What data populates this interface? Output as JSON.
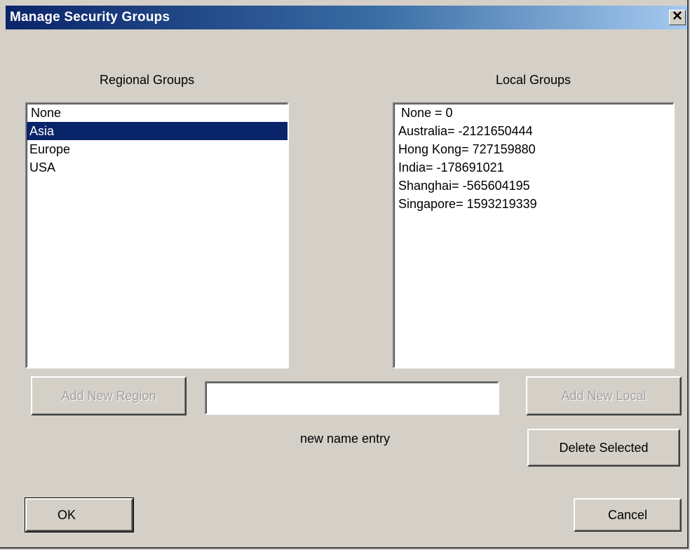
{
  "window": {
    "title": "Manage Security Groups",
    "close_glyph": "✕"
  },
  "regional": {
    "heading": "Regional Groups",
    "items": [
      {
        "label": "None",
        "selected": false
      },
      {
        "label": "Asia",
        "selected": true
      },
      {
        "label": "Europe",
        "selected": false
      },
      {
        "label": "USA",
        "selected": false
      }
    ]
  },
  "local": {
    "heading": "Local Groups",
    "items": [
      {
        "label": "None = 0"
      },
      {
        "label": "Australia= -2121650444"
      },
      {
        "label": "Hong Kong= 727159880"
      },
      {
        "label": "India= -178691021"
      },
      {
        "label": "Shanghai= -565604195"
      },
      {
        "label": "Singapore= 1593219339"
      }
    ]
  },
  "buttons": {
    "add_region": "Add New Region",
    "add_local": "Add New Local",
    "delete_selected": "Delete Selected",
    "ok": "OK",
    "cancel": "Cancel"
  },
  "new_name": {
    "value": "",
    "caption": "new name entry"
  },
  "colors": {
    "dialog_bg": "#d4d0c8",
    "titlebar_start": "#0a246a",
    "titlebar_end": "#a6caf0",
    "selection": "#0a246a",
    "disabled_text": "#a0a0a0"
  }
}
